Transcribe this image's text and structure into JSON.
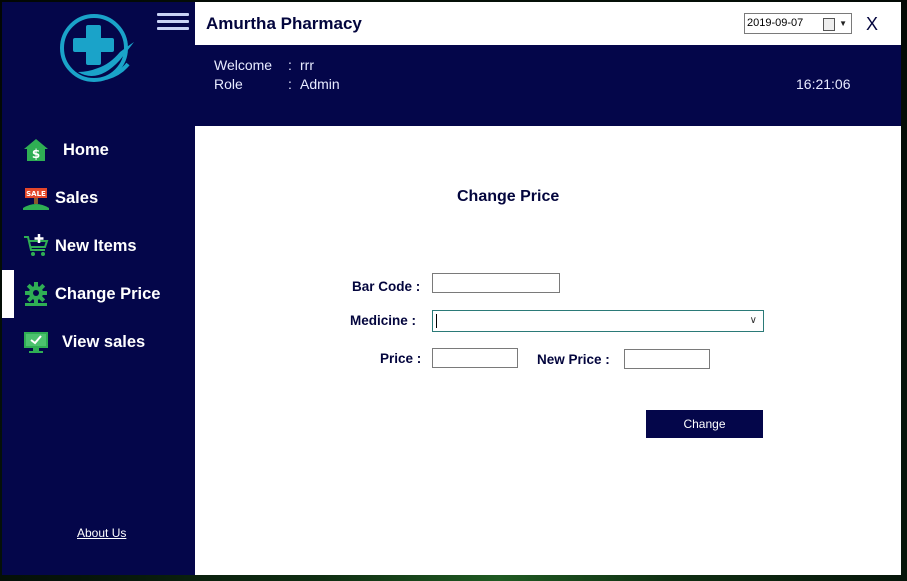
{
  "app": {
    "title": "Amurtha Pharmacy",
    "date": "2019-09-07",
    "close_label": "X"
  },
  "user": {
    "welcome_label": "Welcome",
    "welcome_value": "rrr",
    "role_label": "Role",
    "role_value": "Admin",
    "separator": ":",
    "time": "16:21:06"
  },
  "sidebar": {
    "items": [
      {
        "label": "Home",
        "icon": "home-dollar-icon",
        "active": false
      },
      {
        "label": "Sales",
        "icon": "sale-sign-icon",
        "active": false
      },
      {
        "label": "New Items",
        "icon": "cart-add-icon",
        "active": false
      },
      {
        "label": "Change Price",
        "icon": "gear-icon",
        "active": true
      },
      {
        "label": "View sales",
        "icon": "monitor-check-icon",
        "active": false
      }
    ],
    "about_label": "About Us"
  },
  "form": {
    "title": "Change Price",
    "barcode_label": "Bar Code :",
    "barcode_value": "",
    "medicine_label": "Medicine :",
    "medicine_value": "",
    "price_label": "Price :",
    "price_value": "",
    "new_price_label": "New Price :",
    "new_price_value": "",
    "button_label": "Change"
  },
  "colors": {
    "primary": "#04064a",
    "accent": "#1aa3c9",
    "content_bg": "#ffffff"
  }
}
